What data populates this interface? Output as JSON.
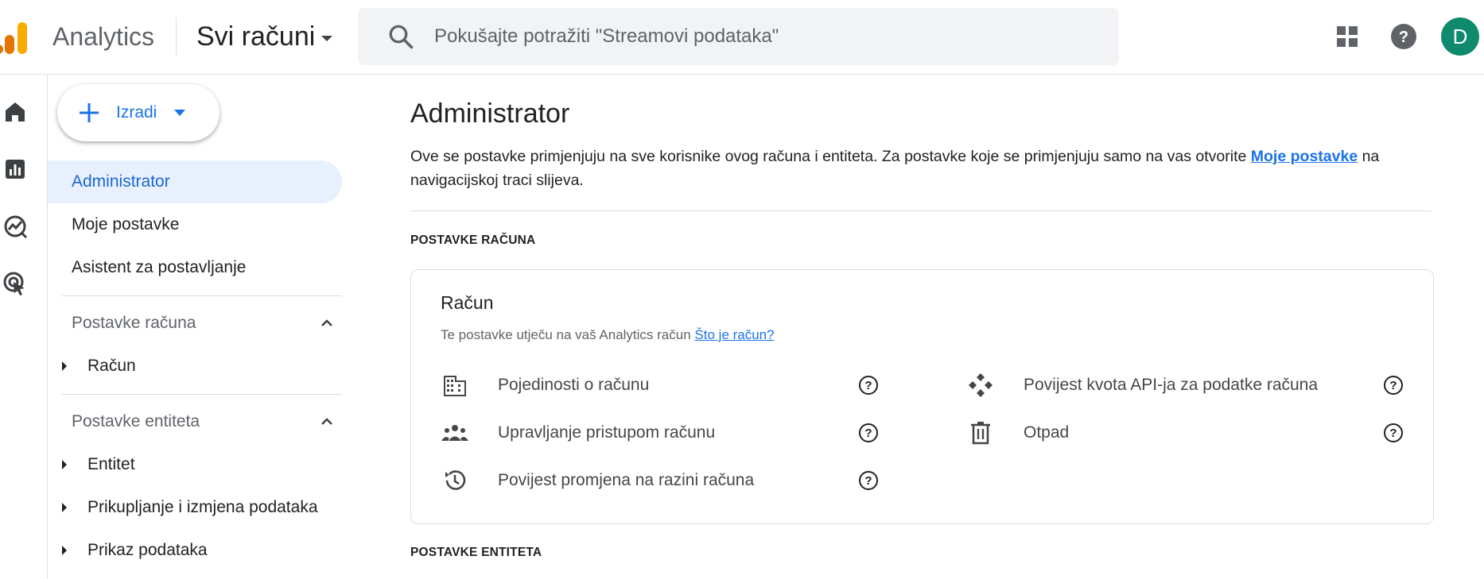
{
  "header": {
    "app_title": "Analytics",
    "account_picker_label": "Svi računi",
    "search_placeholder": "Pokušajte potražiti \"Streamovi podataka\"",
    "avatar_initial": "D",
    "avatar_color": "#0f8a6d"
  },
  "icons": {
    "logo": "analytics-logo",
    "search": "search-icon",
    "apps": "apps-grid-icon",
    "help": "help-icon",
    "rail": [
      "home-icon",
      "reports-icon",
      "explore-icon",
      "advertising-icon"
    ]
  },
  "sidebar": {
    "create_label": "Izradi",
    "items": [
      "Administrator",
      "Moje postavke",
      "Asistent za postavljanje"
    ],
    "account_section": {
      "title": "Postavke računa",
      "items": [
        "Račun"
      ]
    },
    "property_section": {
      "title": "Postavke entiteta",
      "items": [
        "Entitet",
        "Prikupljanje i izmjena podataka",
        "Prikaz podataka"
      ]
    }
  },
  "main": {
    "title": "Administrator",
    "intro_text": "Ove se postavke primjenjuju na sve korisnike ovog računa i entiteta. Za postavke koje se primjenjuju samo na vas otvorite ",
    "intro_link": "Moje postavke",
    "intro_text_end": " na navigacijskoj traci slijeva.",
    "account_settings_label": "POSTAVKE RAČUNA",
    "property_settings_label": "POSTAVKE ENTITETA",
    "card": {
      "title": "Račun",
      "description": "Te postavke utječu na vaš Analytics račun",
      "description_link": "Što je račun?",
      "left_items": [
        "Pojedinosti o računu",
        "Upravljanje pristupom računu",
        "Povijest promjena na razini računa"
      ],
      "right_items": [
        "Povijest kvota API-ja za podatke računa",
        "Otpad"
      ]
    }
  },
  "colors": {
    "accent": "#1a73e8",
    "active_bg": "#e8f0fe",
    "logo_orange": "#f9ab00",
    "logo_dark_orange": "#e37400"
  }
}
